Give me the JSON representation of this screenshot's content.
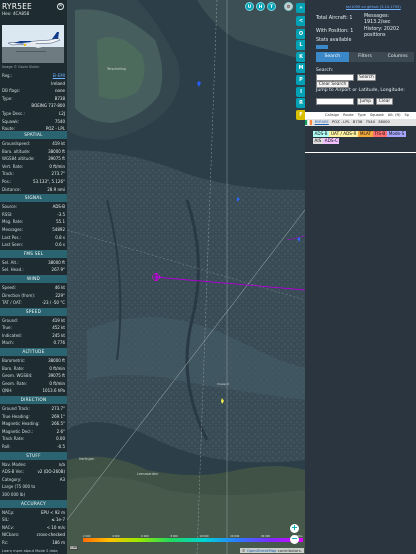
{
  "aircraft": {
    "callsign": "RYR5EE",
    "hex_line": "Hex: 4CA858",
    "photo_credit": "Image © Gavin Sinkin",
    "basic": [
      {
        "k": "Reg.:",
        "v": "EI-EMI",
        "link": true
      },
      {
        "k": "",
        "v": "Ireland",
        "link": false
      },
      {
        "k": "DB flags:",
        "v": "none",
        "link": false
      },
      {
        "k": "Type:",
        "v": "B738",
        "link": false
      },
      {
        "k": "",
        "v": "BOEING 737-800",
        "link": false
      },
      {
        "k": "Type Desc.:",
        "v": "L2J",
        "link": false
      },
      {
        "k": "Squawk:",
        "v": "7540",
        "link": false
      },
      {
        "k": "Route:",
        "v": "POZ - LPL",
        "link": false
      }
    ],
    "sections": [
      {
        "title": "SPATIAL",
        "rows": [
          {
            "k": "Groundspeed:",
            "v": "419 kt"
          },
          {
            "k": "Baro. altitude:",
            "v": "38000 ft"
          },
          {
            "k": "WGS84 altitude:",
            "v": "39075 ft"
          },
          {
            "k": "Vert. Rate:",
            "v": "0 ft/min"
          },
          {
            "k": "Track:",
            "v": "273.7°"
          },
          {
            "k": "Pos.:",
            "v": "53.133°, 5.126°"
          },
          {
            "k": "Distance:",
            "v": "28.9 nmi"
          }
        ]
      },
      {
        "title": "SIGNAL",
        "rows": [
          {
            "k": "Source:",
            "v": "ADS-B"
          },
          {
            "k": "RSSI:",
            "v": "-3.5"
          },
          {
            "k": "Msg. Rate:",
            "v": "55.1"
          },
          {
            "k": "Messages:",
            "v": "54892"
          },
          {
            "k": "Last Pos.:",
            "v": "0.8 s"
          },
          {
            "k": "Last Seen:",
            "v": "0.6 s"
          }
        ]
      },
      {
        "title": "FMS SEL",
        "rows": [
          {
            "k": "Sel. Alt.:",
            "v": "38000 ft"
          },
          {
            "k": "Sel. Head.:",
            "v": "267.9°"
          }
        ]
      },
      {
        "title": "WIND",
        "rows": [
          {
            "k": "Speed:",
            "v": "46 kt"
          },
          {
            "k": "Direction (from):",
            "v": "229°"
          },
          {
            "k": "TAT / OAT:",
            "v": "-23 / -50 °C"
          }
        ]
      },
      {
        "title": "SPEED",
        "rows": [
          {
            "k": "Ground:",
            "v": "419 kt"
          },
          {
            "k": "True:",
            "v": "452 kt"
          },
          {
            "k": "Indicated:",
            "v": "245 kt"
          },
          {
            "k": "Mach:",
            "v": "0.776"
          }
        ]
      },
      {
        "title": "ALTITUDE",
        "rows": [
          {
            "k": "Barometric:",
            "v": "38000 ft"
          },
          {
            "k": "Baro. Rate:",
            "v": "0 ft/min"
          },
          {
            "k": "Geom. WGS84:",
            "v": "39075 ft"
          },
          {
            "k": "Geom. Rate:",
            "v": "0 ft/min"
          },
          {
            "k": "QNH:",
            "v": "1013.6 hPa"
          }
        ]
      },
      {
        "title": "DIRECTION",
        "rows": [
          {
            "k": "Ground Track:",
            "v": "273.7°"
          },
          {
            "k": "True Heading:",
            "v": "269.1°"
          },
          {
            "k": "Magnetic Heading:",
            "v": "266.5°"
          },
          {
            "k": "Magnetic Decl.:",
            "v": "2.6°"
          },
          {
            "k": "Track Rate:",
            "v": "0.00"
          },
          {
            "k": "Roll:",
            "v": "-0.5"
          }
        ]
      },
      {
        "title": "STUFF",
        "rows": [
          {
            "k": "Nav. Modes:",
            "v": "n/a"
          },
          {
            "k": "ADS-B Ver.:",
            "v": "v2 (DO-260B)"
          },
          {
            "k": "Category:",
            "v": "A3"
          },
          {
            "k": "Large (75 000 to",
            "v": ""
          },
          {
            "k": "300 000 lb)",
            "v": ""
          }
        ]
      },
      {
        "title": "ACCURACY",
        "rows": [
          {
            "k": "NACp:",
            "v": "EPU < 92 m"
          },
          {
            "k": "SIL:",
            "v": "≤ 1e-7"
          },
          {
            "k": "NACv:",
            "v": "< 10 m/s"
          },
          {
            "k": "NICbaro:",
            "v": "cross-checked"
          },
          {
            "k": "Rc:",
            "v": "186 m"
          }
        ]
      }
    ],
    "note": "Learn more about Mode S data type by hovering over each data label."
  },
  "map": {
    "buttons_top": [
      "U",
      "H",
      "T"
    ],
    "toolbar": [
      "<",
      "O",
      "L",
      "K",
      "M",
      "P",
      "I",
      "R",
      "F"
    ],
    "zoom_in": "+",
    "zoom_out": "−",
    "attribution_prefix": "© ",
    "attribution_link": "OpenStreetMap",
    "attribution_suffix": " contributors.",
    "scale_label": "3 NM",
    "altitude_scale": [
      "2 000",
      "4 000",
      "6 000",
      "8 000",
      "10 000",
      "20 000",
      "30 000",
      "40 000+"
    ],
    "place_labels": [
      "Leeuwarden",
      "Harlingen",
      "Terschelling",
      "Vlieland"
    ]
  },
  "panel": {
    "link": "tar1090 on github (3.14.1755)",
    "total_aircraft_label": "Total Aircraft: 1",
    "messages_label": "Messages:",
    "messages_value": "1913.2/sec",
    "with_position_label": "With Position: 1",
    "history_label": "History: 20202",
    "history_sub": "positions",
    "stats_label": "Stats available",
    "tabs": [
      "Search",
      "Filters",
      "Columns"
    ],
    "search_label": "Search:",
    "search_button": "Search",
    "clear_search_button": "Clear Search",
    "jump_label": "Jump to Airport or Latitude, Longitude:",
    "jump_button": "Jump",
    "clear_button": "Clear",
    "table_headers": [
      "Callsign",
      "Route",
      "Type",
      "Squawk",
      "Alt. (ft)",
      "Sp"
    ],
    "table_row": [
      "RYR5EE",
      "POZ - LPL",
      "B738",
      "7540",
      "38000",
      ""
    ],
    "legend": [
      {
        "label": "ADS-B",
        "color": "#b1fff5"
      },
      {
        "label": "UAT / ADS-R",
        "color": "#fff2a0"
      },
      {
        "label": "MLAT",
        "color": "#f2a93b"
      },
      {
        "label": "TIS-B",
        "color": "#ff6f6f"
      },
      {
        "label": "Mode-S",
        "color": "#a6a6ff"
      },
      {
        "label": "AIS",
        "color": "#dcdcdc"
      },
      {
        "label": "ADS-C",
        "color": "#f0c0ff"
      }
    ]
  },
  "colors": {
    "accent": "#00a1b5",
    "section_header": "#2a6470",
    "panel_bg": "#1e2b30",
    "right_panel_bg": "#2a3540",
    "track_color": "#b000d6"
  }
}
